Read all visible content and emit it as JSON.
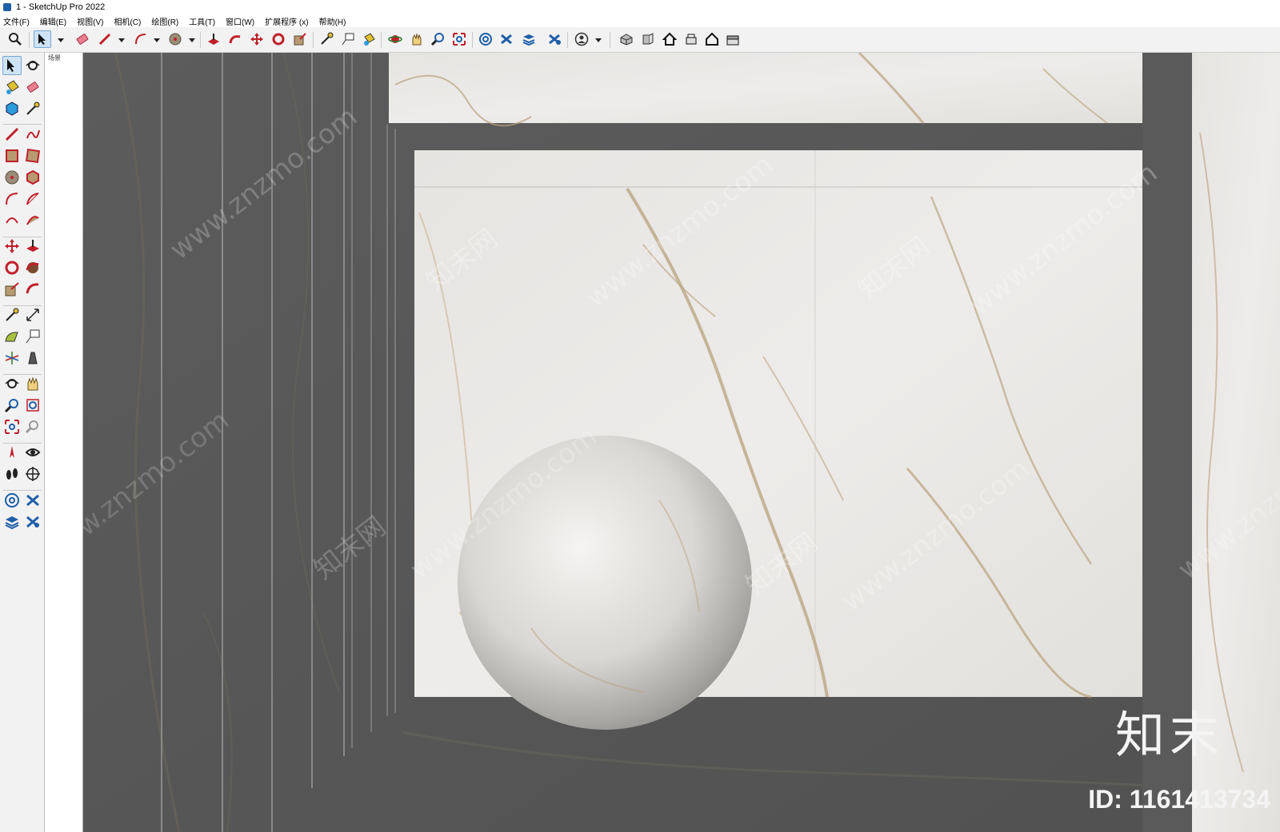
{
  "window": {
    "title": "1 - SketchUp Pro 2022"
  },
  "menu": {
    "items": [
      "文件(F)",
      "编辑(E)",
      "视图(V)",
      "相机(C)",
      "绘图(R)",
      "工具(T)",
      "窗口(W)",
      "扩展程序 (x)",
      "帮助(H)"
    ]
  },
  "toolbar": {
    "tools": [
      "zoom-icon",
      "select-icon",
      "eraser-icon",
      "pencil-line-icon",
      "arc-icon",
      "circle-icon",
      "push-pull-icon",
      "follow-me-icon",
      "move-icon",
      "rotate-icon",
      "scale-icon",
      "tape-measure-icon",
      "text-icon",
      "paint-bucket-icon",
      "orbit-icon",
      "pan-icon",
      "zoom-tool-icon",
      "zoom-extents-icon",
      "warehouse-icon",
      "extension-icon",
      "layers-icon",
      "outliner-icon",
      "account-icon",
      "iso-view-icon",
      "front-view-icon",
      "home-icon",
      "section-icon",
      "house-icon",
      "back-view-icon"
    ]
  },
  "palette": {
    "tools": [
      "select-icon",
      "orbit-icon",
      "paint-bucket-icon",
      "eraser-icon",
      "component-icon",
      "tape-measure-icon",
      "pencil-line-icon",
      "freehand-icon",
      "rectangle-icon",
      "rotated-rectangle-icon",
      "circle-icon",
      "polygon-icon",
      "arc-icon",
      "pie-icon",
      "two-point-arc-icon",
      "three-point-arc-icon",
      "move-icon",
      "push-pull-icon",
      "rotate-icon",
      "follow-me-icon",
      "scale-icon",
      "offset-icon",
      "tape-measure-icon",
      "dimension-icon",
      "protractor-icon",
      "text-icon",
      "axes-icon",
      "3d-text-icon",
      "orbit-icon",
      "pan-icon",
      "zoom-tool-icon",
      "zoom-window-icon",
      "zoom-extents-icon",
      "previous-view-icon",
      "position-camera-icon",
      "look-around-icon",
      "walk-icon",
      "section-plane-icon",
      "warehouse-icon",
      "extension-icon",
      "layers-icon",
      "extension-manager-icon"
    ]
  },
  "scene": {
    "tab_label": "场景"
  },
  "watermark": {
    "site": "www.znzmo.com",
    "brand": "知末网",
    "logo_text": "知末",
    "id_text": "ID: 1161413734"
  },
  "colors": {
    "dark_panel": "#585858",
    "marble_light": "#e8e6e3",
    "vein": "#b8a17c",
    "toolbar_bg": "#f2f2f2",
    "accent": "#1f5fa8"
  }
}
